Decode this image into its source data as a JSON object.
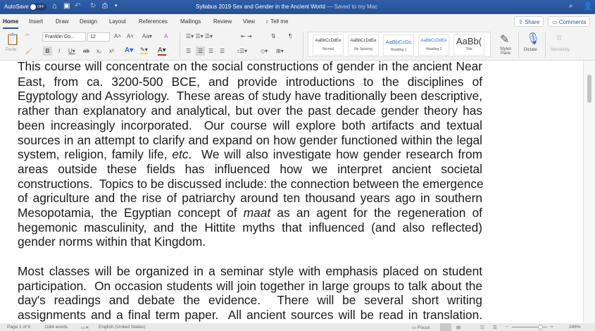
{
  "titlebar": {
    "autosave": "AutoSave",
    "autosave_state": "OFF",
    "doc_title": "Syllabus 2019 Sex and Gender in the Ancient World",
    "saved_status": "— Saved to my Mac"
  },
  "tabs": [
    "Home",
    "Insert",
    "Draw",
    "Design",
    "Layout",
    "References",
    "Mailings",
    "Review",
    "View",
    "Tell me"
  ],
  "share": "Share",
  "comments": "Comments",
  "ribbon": {
    "paste": "Paste",
    "font": "Franklin Go...",
    "size": "12",
    "styles": [
      {
        "preview": "AaBbCcDdEe",
        "name": "Normal"
      },
      {
        "preview": "AaBbCcDdEe",
        "name": "No Spacing"
      },
      {
        "preview": "AaBbCcDc",
        "name": "Heading 1"
      },
      {
        "preview": "AaBbCcDdEe",
        "name": "Heading 2"
      },
      {
        "preview": "AaBb(",
        "name": "Title"
      }
    ],
    "styles_pane": "Styles Pane",
    "dictate": "Dictate",
    "sensitivity": "Sensitivity"
  },
  "document": {
    "lines": [
      [
        {
          "t": "This course will concentrate on the social constructions of gender in the ancient Near"
        }
      ],
      [
        {
          "t": "East, from ca. 3200-500 BCE, and provide introductions to the disciplines of"
        }
      ],
      [
        {
          "t": "Egyptology and Assyriology.  These areas of study have traditionally been descriptive,"
        }
      ],
      [
        {
          "t": "rather than explanatory and analytical, but over the past decade gender theory has"
        }
      ],
      [
        {
          "t": "been increasingly incorporated.  Our course will explore both artifacts and textual"
        }
      ],
      [
        {
          "t": "sources in an attempt to clarify and expand on how gender functioned within the legal"
        }
      ],
      [
        {
          "t": "system, religion, family life, "
        },
        {
          "t": "etc",
          "i": true
        },
        {
          "t": ".  We will also investigate how gender research from"
        }
      ],
      [
        {
          "t": "areas outside these fields has influenced how we interpret ancient societal"
        }
      ],
      [
        {
          "t": "constructions.  Topics to be discussed include: the connection between the emergence"
        }
      ],
      [
        {
          "t": "of agriculture and the rise of patriarchy around ten thousand years ago in southern"
        }
      ],
      [
        {
          "t": "Mesopotamia, the Egyptian concept of "
        },
        {
          "t": "maat",
          "i": true
        },
        {
          "t": " as an agent for the regeneration of"
        }
      ],
      [
        {
          "t": "hegemonic masculinity, and the Hittite myths that influenced (and also reflected)"
        }
      ],
      [
        {
          "t": "gender norms within that Kingdom."
        }
      ],
      [
        {
          "t": "Most classes will be organized in a seminar style with emphasis placed on student"
        }
      ],
      [
        {
          "t": "participation.  On occasion students will join together in large groups to talk about the"
        }
      ],
      [
        {
          "t": "day's readings and debate the evidence.  There will be several short writing"
        }
      ],
      [
        {
          "t": "assignments and a final term paper.  All ancient sources will be read in translation."
        }
      ]
    ]
  },
  "status": {
    "page": "Page 1 of 6",
    "words": "1184 words",
    "language": "English (United States)",
    "focus": "Focus",
    "zoom": "246%"
  }
}
